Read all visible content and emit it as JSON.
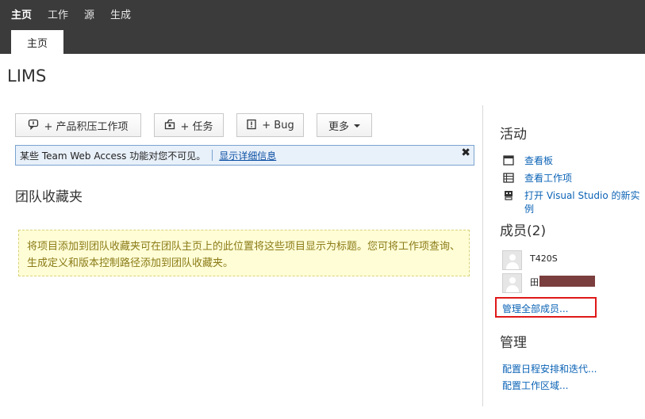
{
  "topnav": {
    "items": [
      "主页",
      "工作",
      "源",
      "生成"
    ],
    "active_index": 0
  },
  "subtab": {
    "label": "主页"
  },
  "project": {
    "title": "LIMS"
  },
  "toolbar": {
    "backlog_label": "+ 产品积压工作项",
    "task_label": "+ 任务",
    "bug_label": "+ Bug",
    "more_label": "更多"
  },
  "infobar": {
    "message": "某些 Team Web Access 功能对您不可见。",
    "link": "显示详细信息",
    "close_glyph": "✖"
  },
  "favorites": {
    "title": "团队收藏夹",
    "note": "将项目添加到团队收藏夹可在团队主页上的此位置将这些项目显示为标题。您可将工作项查询、生成定义和版本控制路径添加到团队收藏夹。"
  },
  "activity": {
    "title": "活动",
    "links": [
      "查看板",
      "查看工作项",
      "打开 Visual Studio 的新实例"
    ]
  },
  "members": {
    "title": "成员(2)",
    "list": [
      "T420S",
      "田"
    ],
    "manage_link": "管理全部成员..."
  },
  "admin": {
    "title": "管理",
    "links": [
      "配置日程安排和迭代...",
      "配置工作区域..."
    ]
  },
  "colors": {
    "topbar": "#3b3b3b",
    "link": "#0b63b6",
    "highlight": "#e01818",
    "note_bg": "#fffdd6",
    "info_bg": "#e8f0fa"
  }
}
